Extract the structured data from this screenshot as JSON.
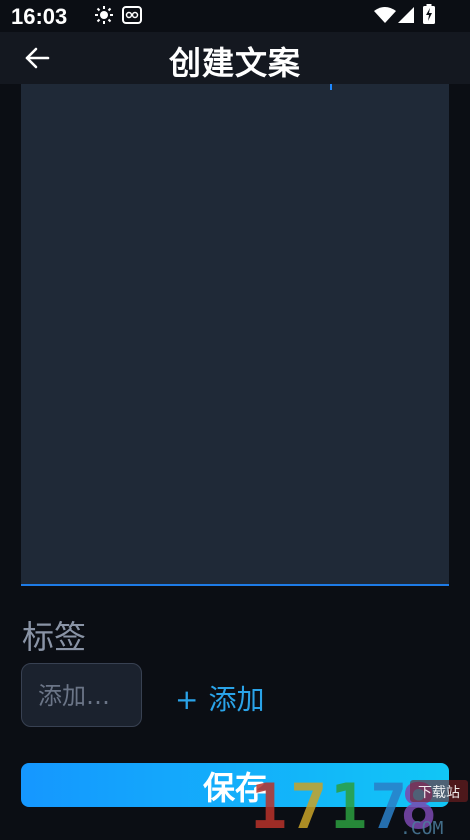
{
  "status_bar": {
    "time": "16:03",
    "icons": [
      "weather-sun-icon",
      "notification-app-icon",
      "wifi-icon",
      "signal-icon",
      "battery-icon"
    ]
  },
  "app_bar": {
    "title": "创建文案",
    "back_icon": "arrow-left-icon"
  },
  "editor": {
    "value": ""
  },
  "tags": {
    "label": "标签",
    "input_placeholder": "添加…",
    "add_label": "添加",
    "add_icon": "plus-icon"
  },
  "save": {
    "label": "保存"
  },
  "watermark": {
    "text": "17178",
    "domain": ".COM",
    "badge": "下载站"
  },
  "colors": {
    "background": "#0b0e14",
    "app_bar": "#141820",
    "editor_bg": "#1f2937",
    "accent": "#1e7be6",
    "save_gradient_start": "#1597ff",
    "save_gradient_end": "#11c6f6"
  }
}
